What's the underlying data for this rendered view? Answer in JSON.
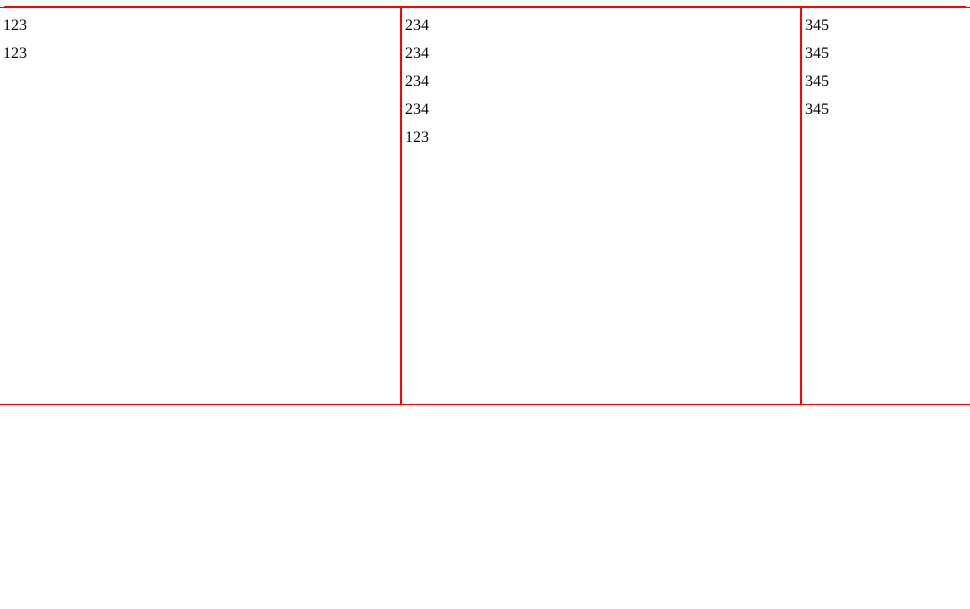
{
  "columns": {
    "col1": {
      "items": [
        "123",
        "123"
      ]
    },
    "col2": {
      "items": [
        "234",
        "234",
        "234",
        "234",
        "123"
      ]
    },
    "col3": {
      "items": [
        "345",
        "345",
        "345",
        "345"
      ]
    }
  }
}
